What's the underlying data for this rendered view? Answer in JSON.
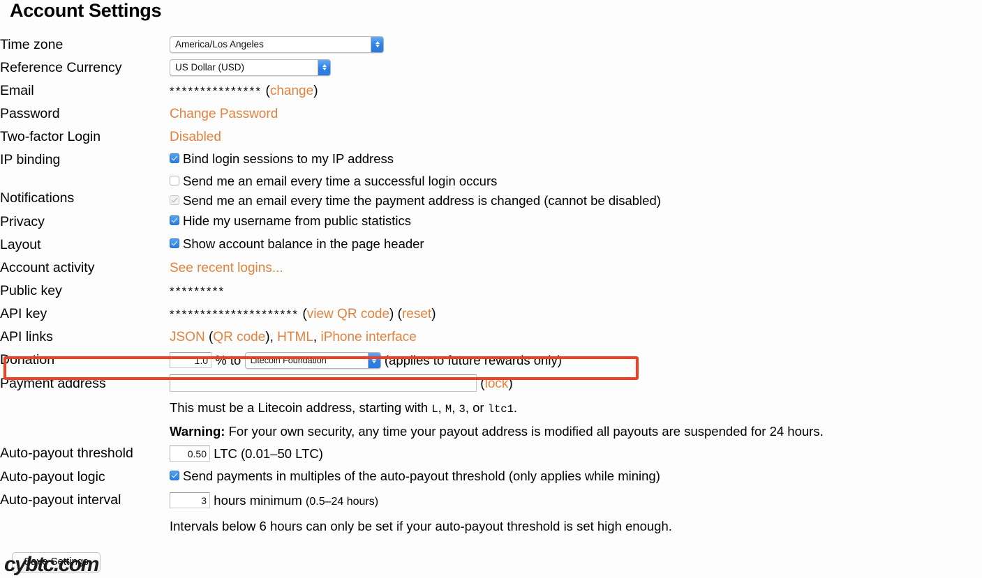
{
  "page": {
    "title": "Account Settings",
    "watermark": "cybtc.com",
    "accent_orange": "#e2823f",
    "highlight_color": "#ec4124",
    "checkbox_blue": "#2a7ce0",
    "background": "#fdfdfd"
  },
  "rows": {
    "timezone": {
      "label": "Time zone",
      "value": "America/Los Angeles"
    },
    "reference_currency": {
      "label": "Reference Currency",
      "value": "US Dollar (USD)"
    },
    "email": {
      "label": "Email",
      "masked": "***************",
      "change_link": "change",
      "paren_open": "(",
      "paren_close": ")"
    },
    "password": {
      "label": "Password",
      "link": "Change Password"
    },
    "two_factor": {
      "label": "Two-factor Login",
      "status": "Disabled"
    },
    "ip_binding": {
      "label": "IP binding",
      "checkbox_label": "Bind login sessions to my IP address",
      "checked": true
    },
    "notifications": {
      "label": "Notifications",
      "items": [
        {
          "text": "Send me an email every time a successful login occurs",
          "checked": false,
          "disabled": false
        },
        {
          "text": "Send me an email every time the payment address is changed (cannot be disabled)",
          "checked": true,
          "disabled": true
        }
      ]
    },
    "privacy": {
      "label": "Privacy",
      "checkbox_label": "Hide my username from public statistics",
      "checked": true
    },
    "layout": {
      "label": "Layout",
      "checkbox_label": "Show account balance in the page header",
      "checked": true
    },
    "account_activity": {
      "label": "Account activity",
      "link": "See recent logins..."
    },
    "public_key": {
      "label": "Public key",
      "masked": "*********"
    },
    "api_key": {
      "label": "API key",
      "masked": "*********************",
      "view_qr_link": "view QR code",
      "reset_link": "reset",
      "paren_open": "(",
      "paren_close": ")"
    },
    "api_links": {
      "label": "API links",
      "json": "JSON",
      "qr_code": "QR code",
      "html": "HTML",
      "iphone": "iPhone interface",
      "sep_comma": ", ",
      "paren_open": "(",
      "paren_close": ")"
    },
    "donation": {
      "label": "Donation",
      "percent_value": "1.0",
      "percent_symbol": "% to",
      "recipient": "Litecoin Foundation",
      "note": "(applies to future rewards only)",
      "highlighted": true
    },
    "payment_address": {
      "label": "Payment address",
      "value": "",
      "placeholder": "",
      "lock_link": "lock",
      "paren_open": "(",
      "paren_close": ")",
      "help_prefix": "This must be a Litecoin address, starting with ",
      "help_codes": [
        "L",
        "M",
        "3",
        "ltc1"
      ],
      "help_sep1": ", ",
      "help_sep2": ", ",
      "help_sep3": ", or ",
      "help_suffix": ".",
      "warning_label": "Warning:",
      "warning_text": " For your own security, any time your payout address is modified all payouts are suspended for 24 hours."
    },
    "auto_payout_threshold": {
      "label": "Auto-payout threshold",
      "value": "0.50",
      "suffix": "LTC (0.01–50 LTC)"
    },
    "auto_payout_logic": {
      "label": "Auto-payout logic",
      "checkbox_label": "Send payments in multiples of the auto-payout threshold (only applies while mining)",
      "checked": true
    },
    "auto_payout_interval": {
      "label": "Auto-payout interval",
      "value": "3",
      "suffix": "hours minimum",
      "hint": "(0.5–24 hours)",
      "note": "Intervals below 6 hours can only be set if your auto-payout threshold is set high enough."
    }
  },
  "actions": {
    "save_label": "Save Settings"
  }
}
